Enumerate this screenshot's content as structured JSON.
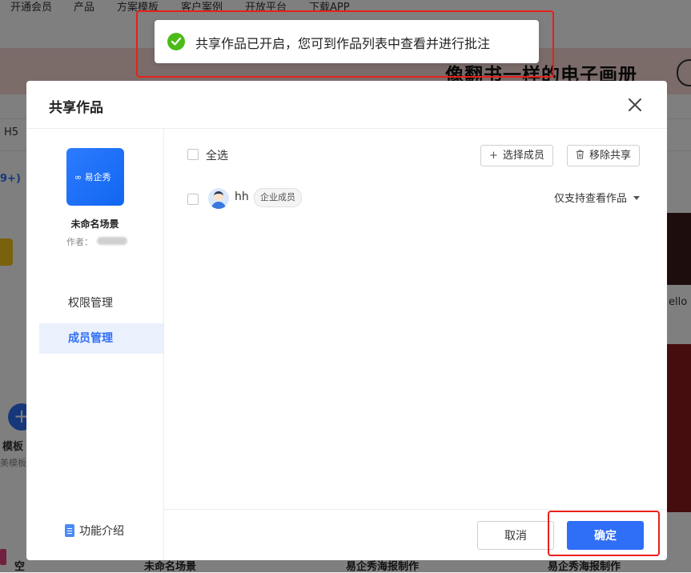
{
  "background": {
    "nav": [
      "开通会员",
      "产品",
      "方案模板",
      "客户案例",
      "开放平台",
      "下载APP"
    ],
    "banner_title": "像翻书一样的电子画册",
    "side_texts": {
      "h5": "H5",
      "count": "9+)",
      "template": "模板",
      "template_sub": "美模板",
      "hello": "ello"
    },
    "bottom_texts": [
      "空",
      "未命名场景",
      "易企秀海报制作",
      "易企秀海报制作"
    ]
  },
  "toast": {
    "message": "共享作品已开启，您可到作品列表中查看并进行批注",
    "icon": "check-circle-icon",
    "color": "#4cbb17"
  },
  "dialog": {
    "title": "共享作品",
    "work": {
      "name": "未命名场景",
      "author_label": "作者：",
      "logo_text": "易企秀"
    },
    "menu": [
      {
        "label": "权限管理",
        "active": false
      },
      {
        "label": "成员管理",
        "active": true
      }
    ],
    "intro_label": "功能介绍",
    "select_all": "全选",
    "select_members_label": "选择成员",
    "remove_share_label": "移除共享",
    "members": [
      {
        "name": "hh",
        "tag": "企业成员",
        "permission": "仅支持查看作品"
      }
    ],
    "cancel_label": "取消",
    "confirm_label": "确定"
  },
  "colors": {
    "accent": "#2f6ef6",
    "highlight": "#e8201a"
  }
}
